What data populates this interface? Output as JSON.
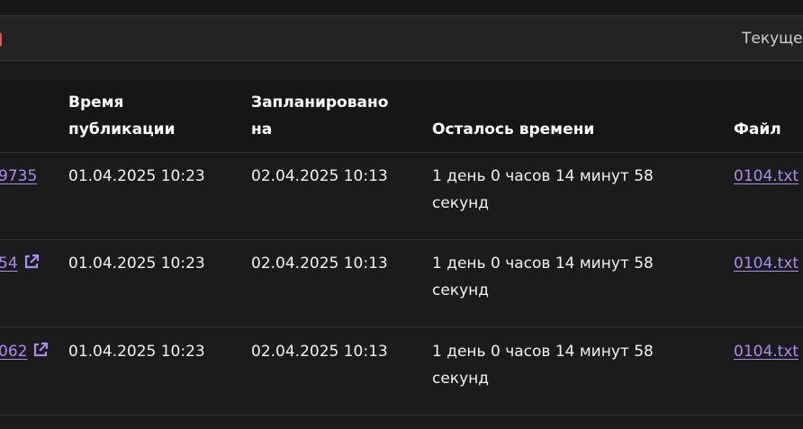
{
  "filter_bar": {
    "current_label": "Текуще"
  },
  "table": {
    "headers": {
      "published_time": "Время публикации",
      "scheduled_for": "Запланировано на",
      "time_left": "Осталось времени",
      "file": "Файл"
    },
    "rows": [
      {
        "id_fragment": "9735",
        "has_external_icon": false,
        "published_time": "01.04.2025 10:23",
        "scheduled_for": "02.04.2025 10:13",
        "time_left": "1 день 0 часов 14 минут 58 секунд",
        "file": "0104.txt"
      },
      {
        "id_fragment": "54",
        "has_external_icon": true,
        "published_time": "01.04.2025 10:23",
        "scheduled_for": "02.04.2025 10:13",
        "time_left": "1 день 0 часов 14 минут 58 секунд",
        "file": "0104.txt"
      },
      {
        "id_fragment": "062",
        "has_external_icon": true,
        "published_time": "01.04.2025 10:23",
        "scheduled_for": "02.04.2025 10:13",
        "time_left": "1 день 0 часов 14 минут 58 секунд",
        "file": "0104.txt"
      }
    ]
  },
  "colors": {
    "background": "#1b1b1b",
    "header_background": "#161616",
    "link": "#a98cf0",
    "accent_red": "#e35656"
  }
}
